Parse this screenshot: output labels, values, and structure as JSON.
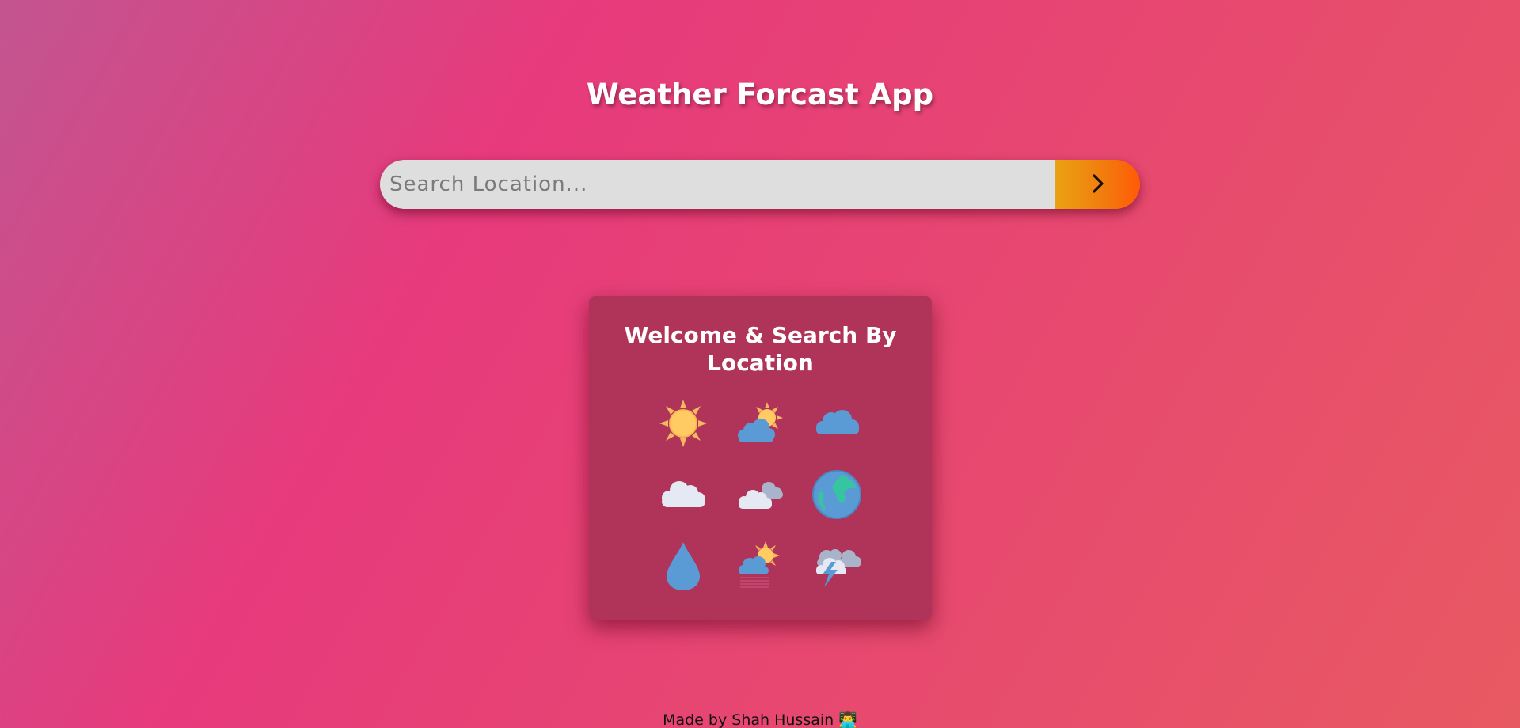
{
  "app": {
    "title": "Weather Forcast App"
  },
  "search": {
    "placeholder": "Search Location...",
    "value": "",
    "submit_icon": "chevron-right-icon"
  },
  "welcome_card": {
    "heading": "Welcome & Search By Location",
    "icons": [
      "sun-icon",
      "partly-sunny-icon",
      "cloud-icon",
      "white-cloud-icon",
      "clouds-icon",
      "globe-icon",
      "raindrop-icon",
      "sun-rain-icon",
      "thunderstorm-icon"
    ]
  },
  "footer": {
    "text": "Made by Shah Hussain 👨‍💻"
  },
  "colors": {
    "accent": "#f27a0e",
    "card": "#b03459",
    "background": "#e7496f"
  }
}
